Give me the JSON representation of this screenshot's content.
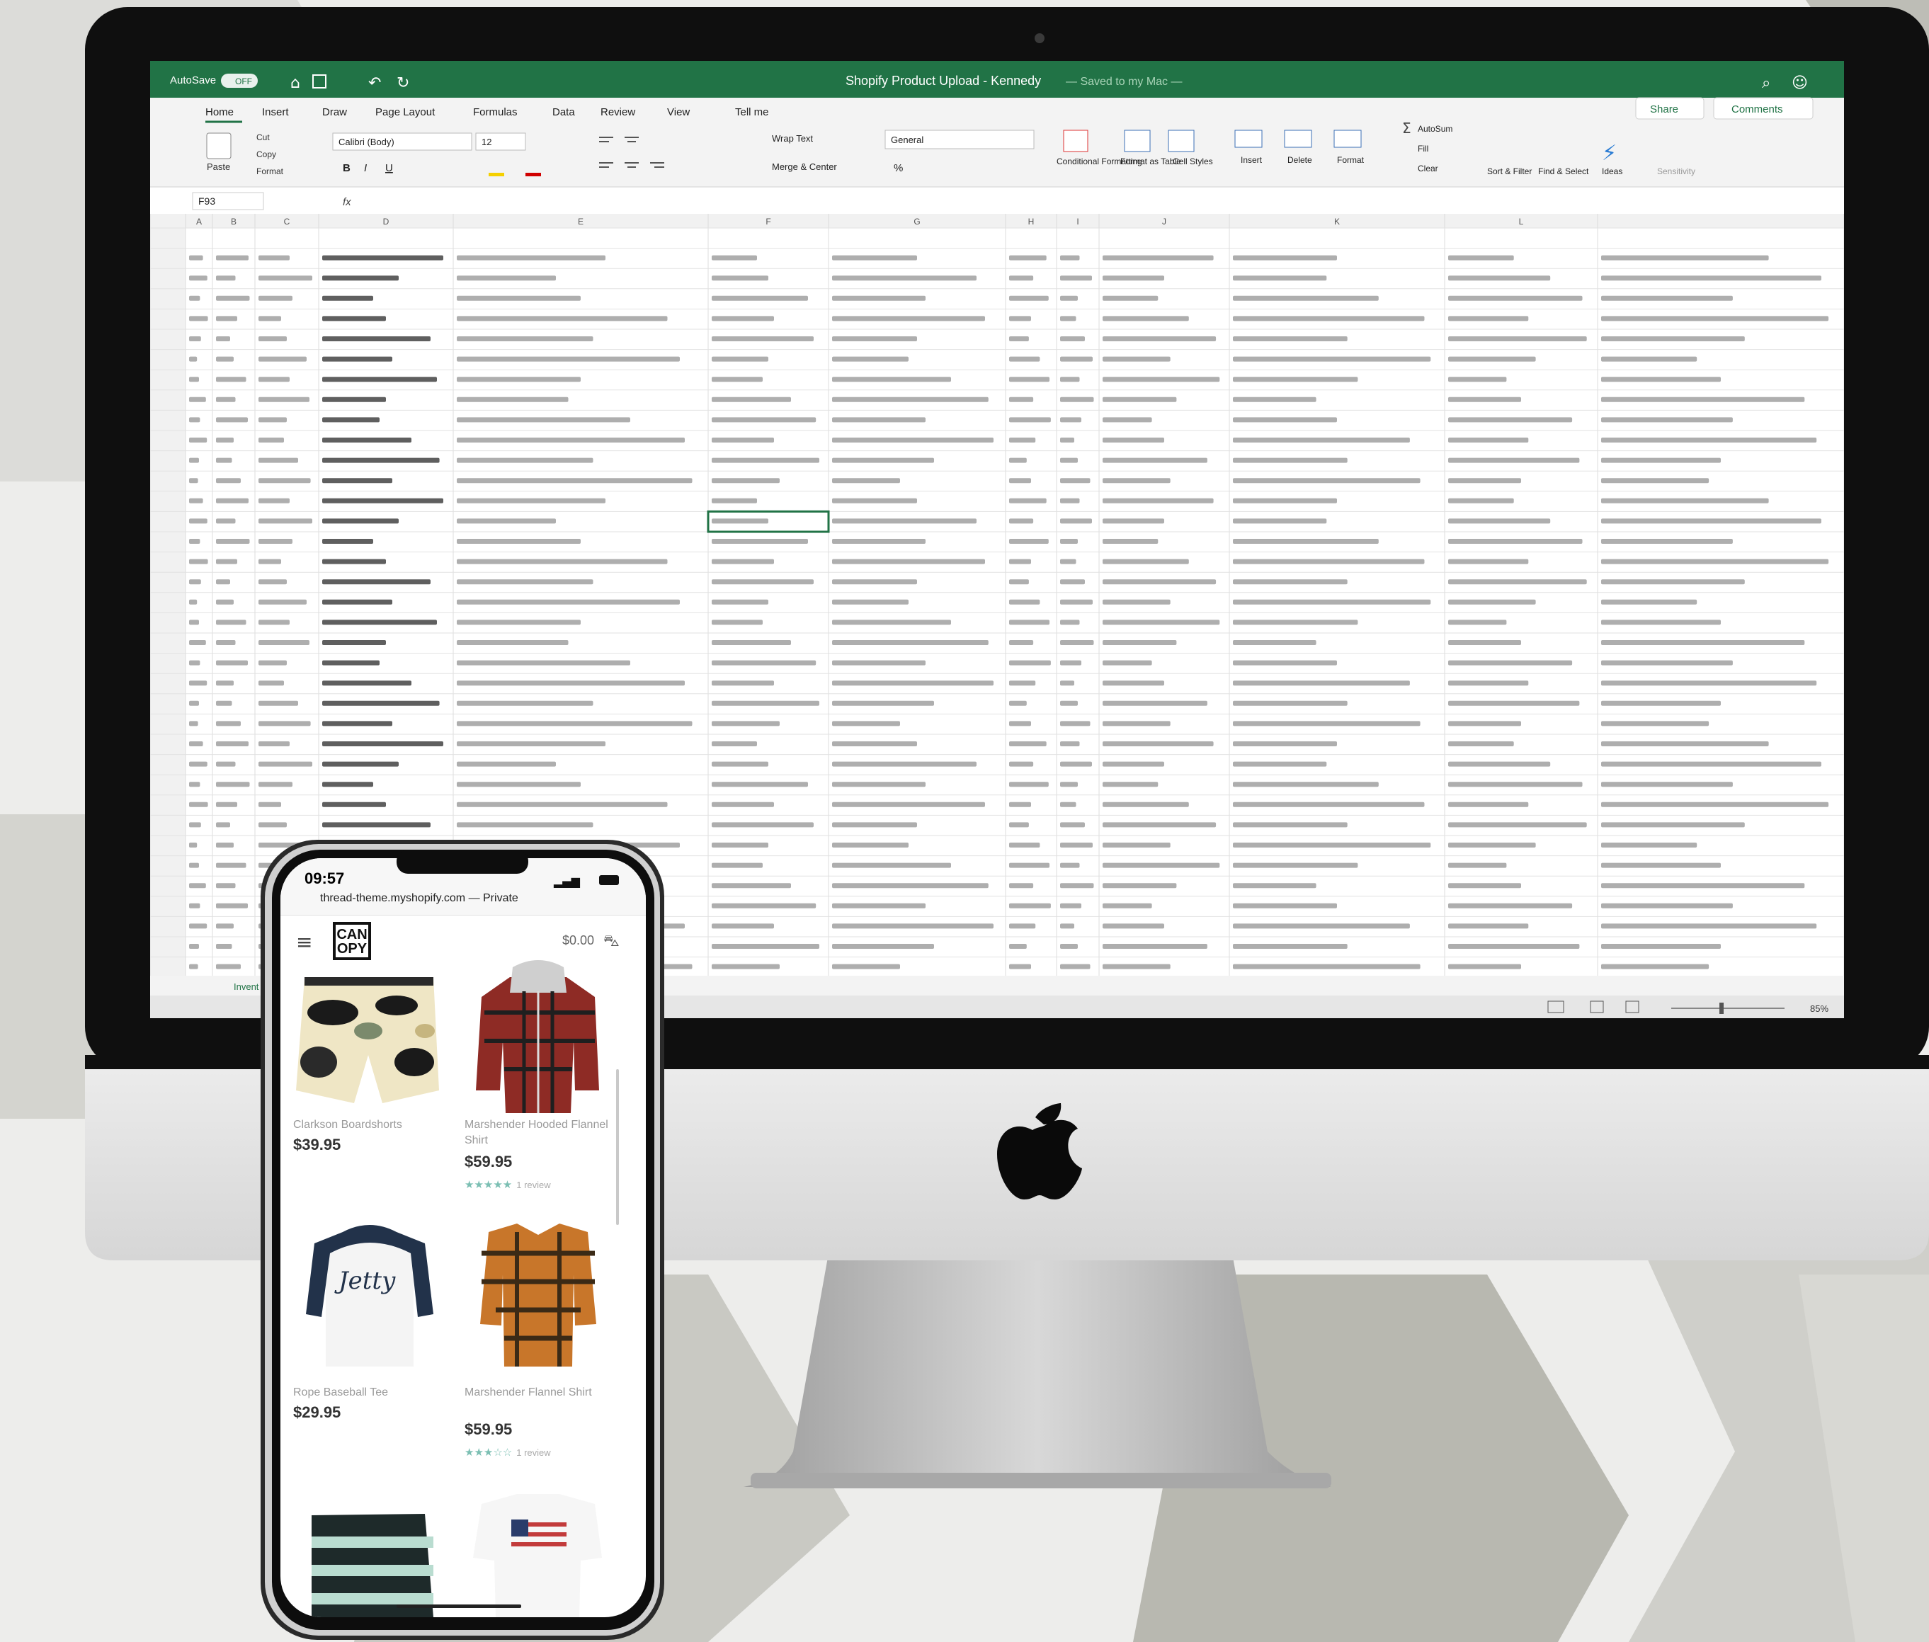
{
  "excel": {
    "autosave_label": "AutoSave",
    "autosave_state": "OFF",
    "window_title": "Shopify Product Upload - Kennedy",
    "saved_status": "— Saved to my Mac —",
    "share_label": "Share",
    "comments_label": "Comments",
    "tabs": [
      "Home",
      "Insert",
      "Draw",
      "Page Layout",
      "Formulas",
      "Data",
      "Review",
      "View",
      "Tell me"
    ],
    "active_tab": "Home",
    "ribbon": {
      "paste": "Paste",
      "cut": "Cut",
      "copy": "Copy",
      "format": "Format",
      "font_name": "Calibri (Body)",
      "font_size": "12",
      "bold": "B",
      "italic": "I",
      "underline": "U",
      "wrap_text": "Wrap Text",
      "merge_center": "Merge & Center",
      "number_format": "General",
      "conditional_formatting": "Conditional Formatting",
      "format_as_table": "Format as Table",
      "cell_styles": "Cell Styles",
      "insert": "Insert",
      "delete": "Delete",
      "format_cells": "Format",
      "autosum": "AutoSum",
      "fill": "Fill",
      "clear": "Clear",
      "sort_filter": "Sort & Filter",
      "find_select": "Find & Select",
      "ideas": "Ideas",
      "sensitivity": "Sensitivity"
    },
    "name_box": "F93",
    "fx": "fx",
    "column_letters": [
      "A",
      "B",
      "C",
      "D",
      "E",
      "F",
      "G",
      "H",
      "I",
      "J",
      "K",
      "L"
    ],
    "zoom": "85%",
    "sheet_tab": "Invent"
  },
  "phone": {
    "time": "09:57",
    "url": "thread-theme.myshopify.com — Private",
    "logo": "CAN OPY",
    "cart_total": "$0.00",
    "products": [
      {
        "name": "Clarkson Boardshorts",
        "price": "$39.95",
        "stars": 0,
        "reviews": ""
      },
      {
        "name": "Marshender Hooded Flannel Shirt",
        "price": "$59.95",
        "stars": 5,
        "reviews": "1 review"
      },
      {
        "name": "Rope Baseball Tee",
        "price": "$29.95",
        "stars": 0,
        "reviews": ""
      },
      {
        "name": "Marshender Flannel Shirt",
        "price": "$59.95",
        "stars": 3,
        "reviews": "1 review"
      }
    ]
  },
  "colors": {
    "excel_green": "#217346",
    "ribbon_bg": "#f3f3f3",
    "imac_bezel": "#0f0f0f",
    "imac_chin": "#e2e2e2",
    "stand": "#b9b9b9",
    "background_light": "#ededeb",
    "background_dark": "#b4b4ad",
    "stars": "#7bbfb3"
  }
}
